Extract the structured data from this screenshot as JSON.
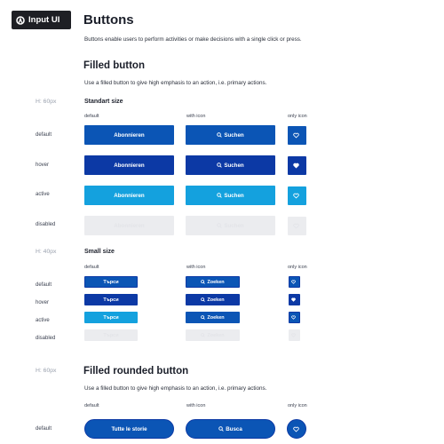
{
  "logo": {
    "text": "Input UI"
  },
  "page": {
    "title": "Buttons",
    "intro": "Buttons enable users to perform activities or make decisions with a single click or press."
  },
  "filled": {
    "title": "Filled button",
    "desc": "Use a filled button to give high emphasis to an action, i.e. primary actions.",
    "standard": {
      "height_note": "H: 60px",
      "title": "Standart size",
      "columns": [
        "default",
        "with icon",
        "only icon"
      ],
      "rows": [
        {
          "state": "default",
          "text_label": "Abonnieren",
          "icon_label": "Suchen"
        },
        {
          "state": "hover",
          "text_label": "Abonnieren",
          "icon_label": "Suchen"
        },
        {
          "state": "active",
          "text_label": "Abonnieren",
          "icon_label": "Suchen"
        },
        {
          "state": "disabled",
          "text_label": "Abonnieren",
          "icon_label": "Suchen"
        }
      ]
    },
    "small": {
      "height_note": "H: 40px",
      "title": "Small size",
      "columns": [
        "default",
        "with icon",
        "only icon"
      ],
      "rows": [
        {
          "state": "default",
          "text_label": "Търси",
          "icon_label": "Zoeken"
        },
        {
          "state": "hover",
          "text_label": "Търси",
          "icon_label": "Zoeken"
        },
        {
          "state": "active",
          "text_label": "Търси",
          "icon_label": "Zoeken"
        },
        {
          "state": "disabled",
          "text_label": "Търси",
          "icon_label": "Zoeken"
        }
      ]
    }
  },
  "rounded": {
    "height_note": "H: 60px",
    "title": "Filled rounded button",
    "desc": "Use a filled button to give high emphasis to an action, i.e. primary actions.",
    "columns": [
      "default",
      "with icon",
      "only icon"
    ],
    "rows": [
      {
        "state": "default",
        "text_label": "Tutte le storie",
        "icon_label": "Busca"
      }
    ]
  },
  "icons": {
    "search": "search-icon",
    "heart": "heart-icon",
    "logo": "logo-mark-icon"
  },
  "colors": {
    "default": "#0b55b5",
    "hover": "#0c39a5",
    "active": "#14a1de",
    "disabled": "#ebecef",
    "logo_bg": "#1e1f24"
  }
}
